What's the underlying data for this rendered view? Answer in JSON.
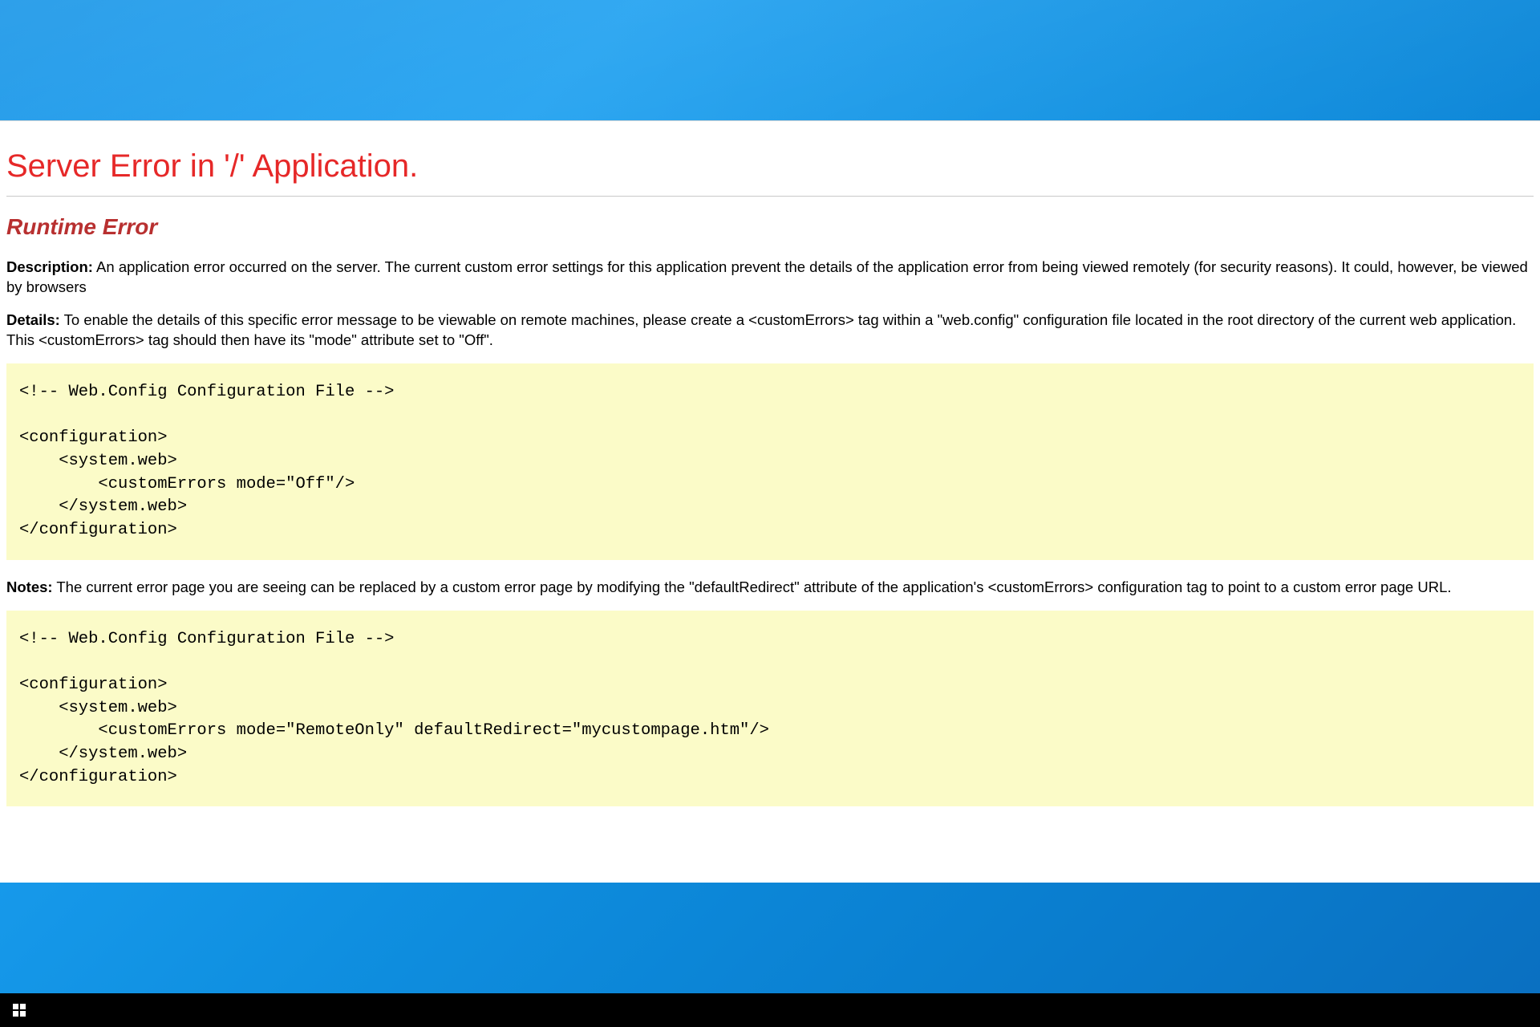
{
  "error": {
    "title": "Server Error in '/' Application.",
    "subtitle": "Runtime Error",
    "description_label": "Description:",
    "description_text": " An application error occurred on the server. The current custom error settings for this application prevent the details of the application error from being viewed remotely (for security reasons). It could, however, be viewed by browsers",
    "details_label": "Details:",
    "details_text": " To enable the details of this specific error message to be viewable on remote machines, please create a <customErrors> tag within a \"web.config\" configuration file located in the root directory of the current web application. This <customErrors> tag should then have its \"mode\" attribute set to \"Off\".",
    "code1": "<!-- Web.Config Configuration File -->\n\n<configuration>\n    <system.web>\n        <customErrors mode=\"Off\"/>\n    </system.web>\n</configuration>",
    "notes_label": "Notes:",
    "notes_text": " The current error page you are seeing can be replaced by a custom error page by modifying the \"defaultRedirect\" attribute of the application's <customErrors> configuration tag to point to a custom error page URL.",
    "code2": "<!-- Web.Config Configuration File -->\n\n<configuration>\n    <system.web>\n        <customErrors mode=\"RemoteOnly\" defaultRedirect=\"mycustompage.htm\"/>\n    </system.web>\n</configuration>"
  }
}
